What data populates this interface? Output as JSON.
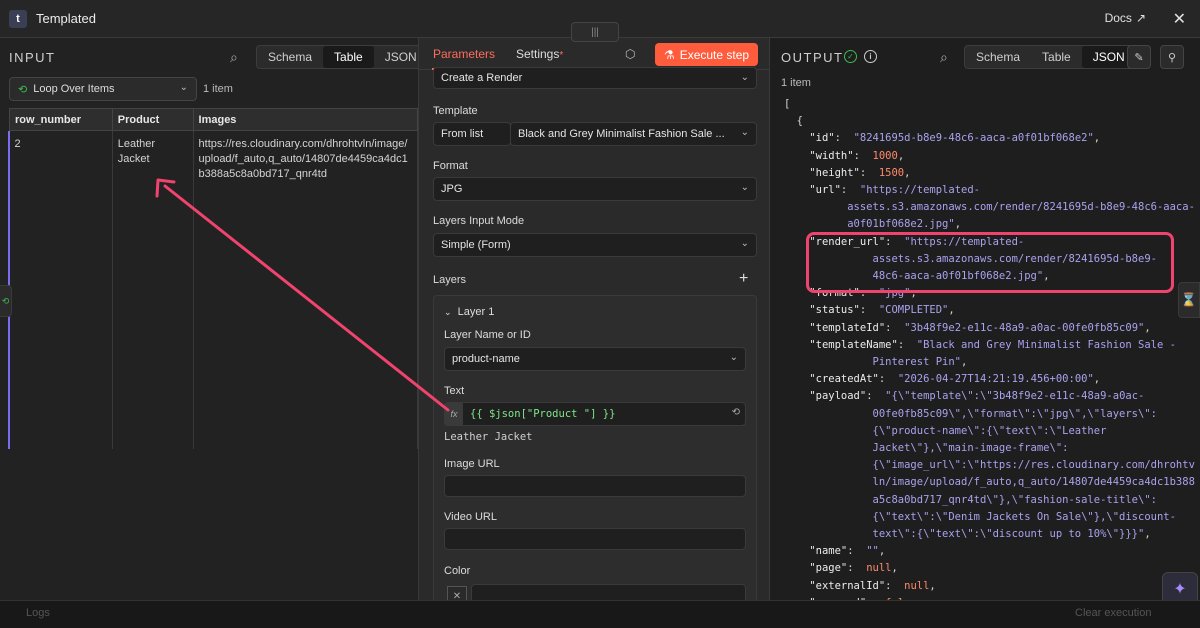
{
  "app": {
    "logo": "t",
    "title": "Templated",
    "docs_label": "Docs"
  },
  "input": {
    "header": "INPUT",
    "views": [
      "Schema",
      "Table",
      "JSON"
    ],
    "active_view": "Table",
    "loop_select": "Loop Over Items",
    "item_count": "1 item",
    "columns": [
      "row_number",
      "Product",
      "Images"
    ],
    "row": {
      "row_number": "2",
      "product": "Leather Jacket",
      "images": "https://res.cloudinary.com/dhrohtvln/image/upload/f_auto,q_auto/14807de4459ca4dc1b388a5c8a0bd717_qnr4td"
    }
  },
  "params": {
    "tabs": [
      "Parameters",
      "Settings"
    ],
    "settings_dot": "*",
    "execute_label": "Execute step",
    "operation": "Create a Render",
    "template_label": "Template",
    "template_mode": "From list",
    "template_value": "Black and Grey Minimalist Fashion Sale ...",
    "format_label": "Format",
    "format_value": "JPG",
    "layers_input_label": "Layers Input Mode",
    "layers_input_value": "Simple (Form)",
    "layers_label": "Layers",
    "layer_title": "Layer 1",
    "layer_name_label": "Layer Name or ID",
    "layer_name_value": "product-name",
    "text_label": "Text",
    "text_expr": "{{ $json[\"Product \"] }}",
    "text_result": "Leather Jacket",
    "image_url_label": "Image URL",
    "video_url_label": "Video URL",
    "color_label": "Color"
  },
  "output": {
    "header": "OUTPUT",
    "views": [
      "Schema",
      "Table",
      "JSON"
    ],
    "active_view": "JSON",
    "item_count": "1 item",
    "json_lines": [
      [
        [
          "p",
          "["
        ]
      ],
      [
        [
          "p",
          "  {"
        ]
      ],
      [
        [
          "p",
          "    "
        ],
        [
          "k",
          "\"id\""
        ],
        [
          "p",
          ":  "
        ],
        [
          "s",
          "\"8241695d-b8e9-48c6-aaca-a0f01bf068e2\""
        ],
        [
          "p",
          ","
        ]
      ],
      [
        [
          "p",
          "    "
        ],
        [
          "k",
          "\"width\""
        ],
        [
          "p",
          ":  "
        ],
        [
          "n",
          "1000"
        ],
        [
          "p",
          ","
        ]
      ],
      [
        [
          "p",
          "    "
        ],
        [
          "k",
          "\"height\""
        ],
        [
          "p",
          ":  "
        ],
        [
          "n",
          "1500"
        ],
        [
          "p",
          ","
        ]
      ],
      [
        [
          "p",
          "    "
        ],
        [
          "k",
          "\"url\""
        ],
        [
          "p",
          ":  "
        ],
        [
          "s",
          "\"https://templated-"
        ]
      ],
      [
        [
          "s",
          "          assets.s3.amazonaws.com/render/8241695d-b8e9-48c6-aaca-"
        ]
      ],
      [
        [
          "s",
          "          a0f01bf068e2.jpg\""
        ],
        [
          "p",
          ","
        ]
      ],
      [
        [
          "p",
          "    "
        ],
        [
          "k",
          "\"render_url\""
        ],
        [
          "p",
          ":  "
        ],
        [
          "s",
          "\"https://templated-"
        ]
      ],
      [
        [
          "s",
          "              assets.s3.amazonaws.com/render/8241695d-b8e9-"
        ]
      ],
      [
        [
          "s",
          "              48c6-aaca-a0f01bf068e2.jpg\""
        ],
        [
          "p",
          ","
        ]
      ],
      [
        [
          "p",
          "    "
        ],
        [
          "k",
          "\"format\""
        ],
        [
          "p",
          ":  "
        ],
        [
          "s",
          "\"jpg\""
        ],
        [
          "p",
          ","
        ]
      ],
      [
        [
          "p",
          "    "
        ],
        [
          "k",
          "\"status\""
        ],
        [
          "p",
          ":  "
        ],
        [
          "s",
          "\"COMPLETED\""
        ],
        [
          "p",
          ","
        ]
      ],
      [
        [
          "p",
          "    "
        ],
        [
          "k",
          "\"templateId\""
        ],
        [
          "p",
          ":  "
        ],
        [
          "s",
          "\"3b48f9e2-e11c-48a9-a0ac-00fe0fb85c09\""
        ],
        [
          "p",
          ","
        ]
      ],
      [
        [
          "p",
          "    "
        ],
        [
          "k",
          "\"templateName\""
        ],
        [
          "p",
          ":  "
        ],
        [
          "s",
          "\"Black and Grey Minimalist Fashion Sale -"
        ]
      ],
      [
        [
          "s",
          "              Pinterest Pin\""
        ],
        [
          "p",
          ","
        ]
      ],
      [
        [
          "p",
          "    "
        ],
        [
          "k",
          "\"createdAt\""
        ],
        [
          "p",
          ":  "
        ],
        [
          "s",
          "\"2026-04-27T14:21:19.456+00:00\""
        ],
        [
          "p",
          ","
        ]
      ],
      [
        [
          "p",
          "    "
        ],
        [
          "k",
          "\"payload\""
        ],
        [
          "p",
          ":  "
        ],
        [
          "s",
          "\"{\\\"template\\\":\\\"3b48f9e2-e11c-48a9-a0ac-"
        ]
      ],
      [
        [
          "s",
          "              00fe0fb85c09\\\",\\\"format\\\":\\\"jpg\\\",\\\"layers\\\":"
        ]
      ],
      [
        [
          "s",
          "              {\\\"product-name\\\":{\\\"text\\\":\\\"Leather"
        ]
      ],
      [
        [
          "s",
          "              Jacket\\\"},\\\"main-image-frame\\\":"
        ]
      ],
      [
        [
          "s",
          "              {\\\"image_url\\\":\\\"https://res.cloudinary.com/dhrohtv"
        ]
      ],
      [
        [
          "s",
          "              ln/image/upload/f_auto,q_auto/14807de4459ca4dc1b388"
        ]
      ],
      [
        [
          "s",
          "              a5c8a0bd717_qnr4td\\\"},\\\"fashion-sale-title\\\":"
        ]
      ],
      [
        [
          "s",
          "              {\\\"text\\\":\\\"Denim Jackets On Sale\\\"},\\\"discount-"
        ]
      ],
      [
        [
          "s",
          "              text\\\":{\\\"text\\\":\\\"discount up to 10%\\\"}}}\""
        ],
        [
          "p",
          ","
        ]
      ],
      [
        [
          "p",
          "    "
        ],
        [
          "k",
          "\"name\""
        ],
        [
          "p",
          ":  "
        ],
        [
          "s",
          "\"\""
        ],
        [
          "p",
          ","
        ]
      ],
      [
        [
          "p",
          "    "
        ],
        [
          "k",
          "\"page\""
        ],
        [
          "p",
          ":  "
        ],
        [
          "n",
          "null"
        ],
        [
          "p",
          ","
        ]
      ],
      [
        [
          "p",
          "    "
        ],
        [
          "k",
          "\"externalId\""
        ],
        [
          "p",
          ":  "
        ],
        [
          "n",
          "null"
        ],
        [
          "p",
          ","
        ]
      ],
      [
        [
          "p",
          "    "
        ],
        [
          "k",
          "\"removed\""
        ],
        [
          "p",
          ":  "
        ],
        [
          "n",
          "false"
        ]
      ]
    ]
  },
  "footer": {
    "logs": "Logs",
    "clear": "Clear execution"
  },
  "colors": {
    "accent": "#ff6d5a",
    "highlight": "#f0436e",
    "success": "#3fb950"
  }
}
